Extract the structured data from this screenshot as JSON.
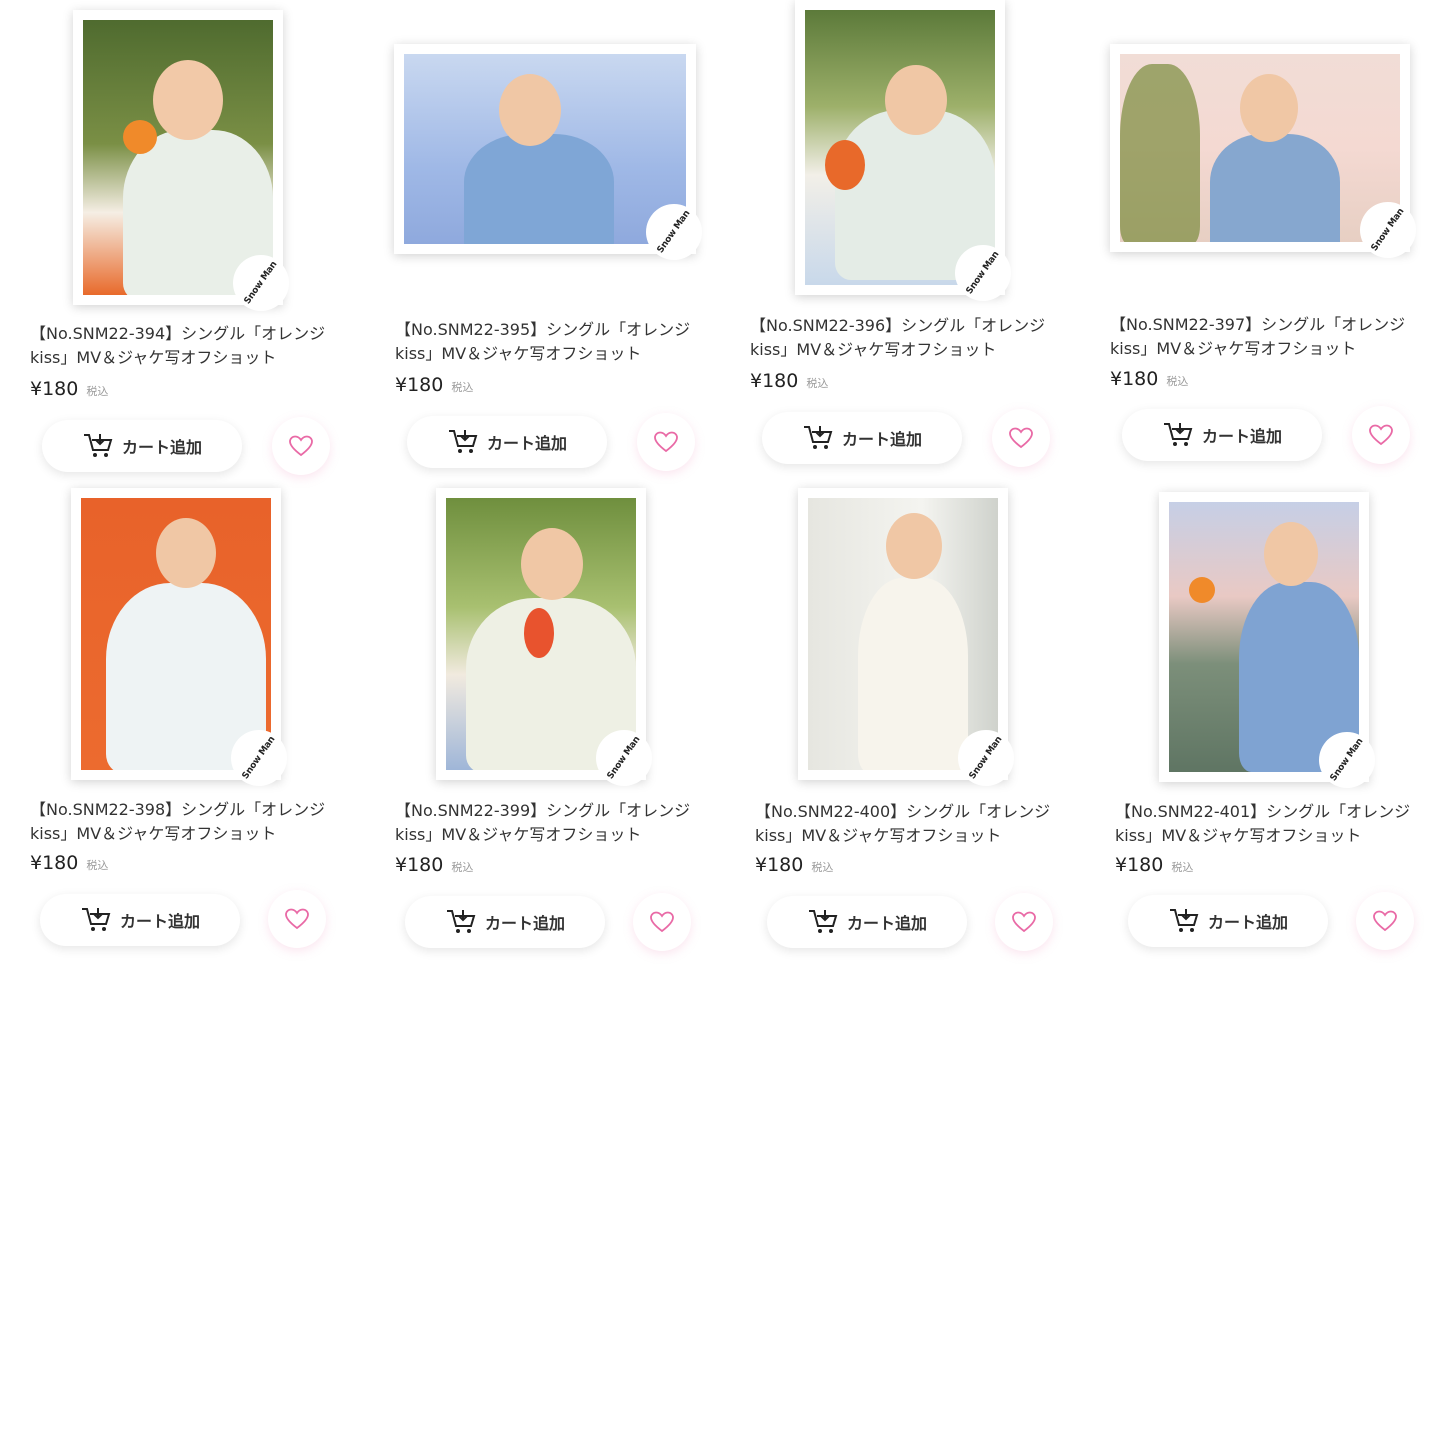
{
  "colors": {
    "heart": "#e96aa6",
    "text": "#333333",
    "tax_text": "#999999"
  },
  "products": [
    {
      "title": "【No.SNM22-394】シングル「オレンジkiss」MV＆ジャケ写オフショット",
      "price": "¥180",
      "tax_label": "税込",
      "cart_label": "カート追加",
      "logo_text": "Snow Man"
    },
    {
      "title": "【No.SNM22-395】シングル「オレンジkiss」MV＆ジャケ写オフショット",
      "price": "¥180",
      "tax_label": "税込",
      "cart_label": "カート追加",
      "logo_text": "Snow Man"
    },
    {
      "title": "【No.SNM22-396】シングル「オレンジkiss」MV＆ジャケ写オフショット",
      "price": "¥180",
      "tax_label": "税込",
      "cart_label": "カート追加",
      "logo_text": "Snow Man"
    },
    {
      "title": "【No.SNM22-397】シングル「オレンジkiss」MV＆ジャケ写オフショット",
      "price": "¥180",
      "tax_label": "税込",
      "cart_label": "カート追加",
      "logo_text": "Snow Man"
    },
    {
      "title": "【No.SNM22-398】シングル「オレンジkiss」MV＆ジャケ写オフショット",
      "price": "¥180",
      "tax_label": "税込",
      "cart_label": "カート追加",
      "logo_text": "Snow Man"
    },
    {
      "title": "【No.SNM22-399】シングル「オレンジkiss」MV＆ジャケ写オフショット",
      "price": "¥180",
      "tax_label": "税込",
      "cart_label": "カート追加",
      "logo_text": "Snow Man"
    },
    {
      "title": "【No.SNM22-400】シングル「オレンジkiss」MV＆ジャケ写オフショット",
      "price": "¥180",
      "tax_label": "税込",
      "cart_label": "カート追加",
      "logo_text": "Snow Man"
    },
    {
      "title": "【No.SNM22-401】シングル「オレンジkiss」MV＆ジャケ写オフショット",
      "price": "¥180",
      "tax_label": "税込",
      "cart_label": "カート追加",
      "logo_text": "Snow Man"
    }
  ]
}
